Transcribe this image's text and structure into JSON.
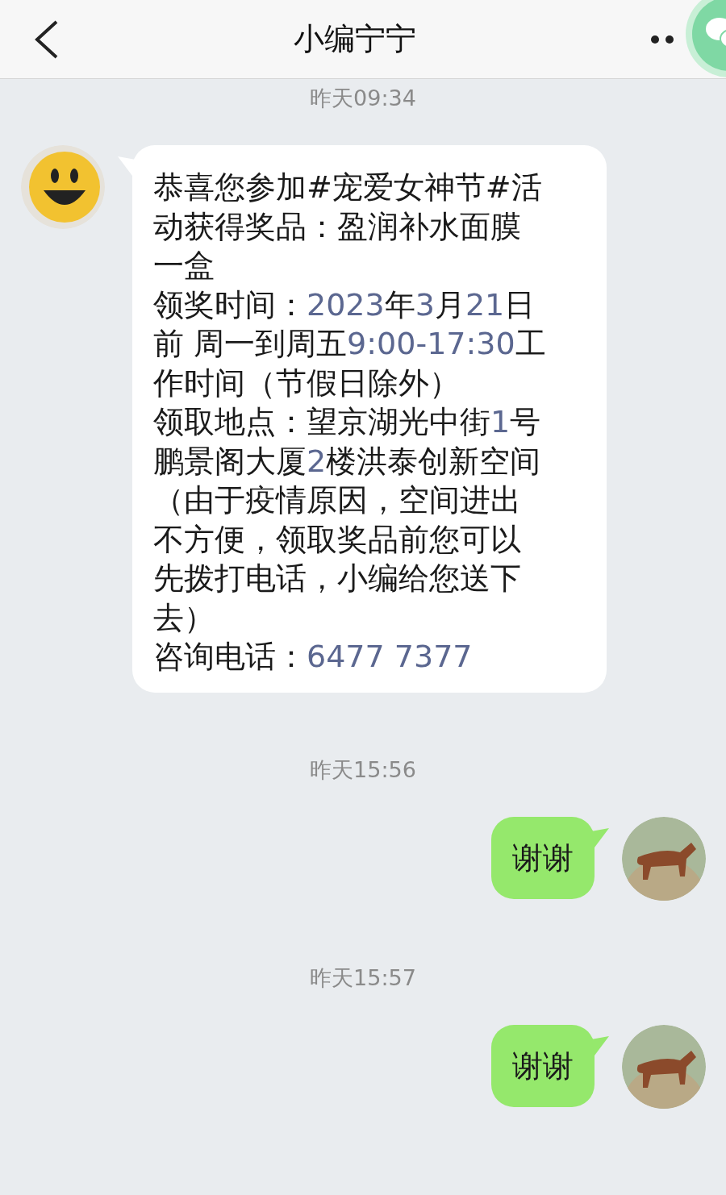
{
  "header": {
    "title": "小编宁宁"
  },
  "messages": [
    {
      "kind": "time",
      "text": "昨天09:34"
    },
    {
      "kind": "incoming",
      "lines": [
        {
          "segments": [
            {
              "kind": "plain",
              "text": "恭喜您参加#宠爱女神节#活"
            }
          ]
        },
        {
          "segments": [
            {
              "kind": "plain",
              "text": "动获得奖品：盈润补水面膜"
            }
          ]
        },
        {
          "segments": [
            {
              "kind": "plain",
              "text": "一盒"
            }
          ]
        },
        {
          "segments": [
            {
              "kind": "plain",
              "text": "领奖时间："
            },
            {
              "kind": "number",
              "text": "2023"
            },
            {
              "kind": "plain",
              "text": "年"
            },
            {
              "kind": "number",
              "text": "3"
            },
            {
              "kind": "plain",
              "text": "月"
            },
            {
              "kind": "number",
              "text": "21"
            },
            {
              "kind": "plain",
              "text": "日"
            }
          ]
        },
        {
          "segments": [
            {
              "kind": "plain",
              "text": "前 周一到周五"
            },
            {
              "kind": "number",
              "text": "9:00-17:30"
            },
            {
              "kind": "plain",
              "text": "工"
            }
          ]
        },
        {
          "segments": [
            {
              "kind": "plain",
              "text": "作时间（节假日除外）"
            }
          ]
        },
        {
          "segments": [
            {
              "kind": "plain",
              "text": "领取地点：望京湖光中街"
            },
            {
              "kind": "number",
              "text": "1"
            },
            {
              "kind": "plain",
              "text": "号"
            }
          ]
        },
        {
          "segments": [
            {
              "kind": "plain",
              "text": "鹏景阁大厦"
            },
            {
              "kind": "number",
              "text": "2"
            },
            {
              "kind": "plain",
              "text": "楼洪泰创新空间"
            }
          ]
        },
        {
          "segments": [
            {
              "kind": "plain",
              "text": "（由于疫情原因，空间进出"
            }
          ]
        },
        {
          "segments": [
            {
              "kind": "plain",
              "text": "不方便，领取奖品前您可以"
            }
          ]
        },
        {
          "segments": [
            {
              "kind": "plain",
              "text": "先拨打电话，小编给您送下"
            }
          ]
        },
        {
          "segments": [
            {
              "kind": "plain",
              "text": "去）"
            }
          ]
        },
        {
          "segments": [
            {
              "kind": "plain",
              "text": "咨询电话："
            },
            {
              "kind": "number",
              "text": "6477 7377"
            }
          ]
        }
      ]
    },
    {
      "kind": "time",
      "text": "昨天15:56"
    },
    {
      "kind": "outgoing",
      "lines": [
        {
          "segments": [
            {
              "kind": "plain",
              "text": "谢谢"
            }
          ]
        }
      ]
    },
    {
      "kind": "time",
      "text": "昨天15:57"
    },
    {
      "kind": "outgoing",
      "lines": [
        {
          "segments": [
            {
              "kind": "plain",
              "text": "谢谢"
            }
          ]
        }
      ]
    }
  ]
}
